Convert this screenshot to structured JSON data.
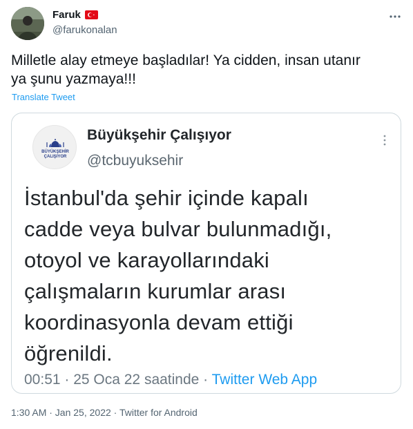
{
  "author": {
    "display_name": "Faruk",
    "handle": "@farukonalan",
    "flag_icon": "turkey-flag-icon"
  },
  "tweet": {
    "text": "Milletle alay etmeye başladılar! Ya cidden, insan utanır\nya şunu yazmaya!!!",
    "translate_label": "Translate Tweet",
    "timestamp": "1:30 AM · Jan 25, 2022 · Twitter for Android"
  },
  "quoted": {
    "display_name": "Büyükşehir Çalışıyor",
    "handle": "@tcbuyuksehir",
    "logo_text": "BÜYÜKŞEHİR\nÇALIŞIYOR",
    "text": "İstanbul'da şehir içinde kapalı\ncadde veya bulvar bulunmadığı,\notoyol ve karayollarındaki\nçalışmaların kurumlar arası\nkoordinasyonla devam ettiği\nöğrenildi.",
    "meta_time": "00:51 · 25 Oca 22 saatinde · ",
    "meta_source": "Twitter Web App"
  },
  "colors": {
    "link": "#1d9bf0",
    "secondary_text": "#536471",
    "border": "#cfd9de",
    "flag_red": "#e30a17"
  }
}
